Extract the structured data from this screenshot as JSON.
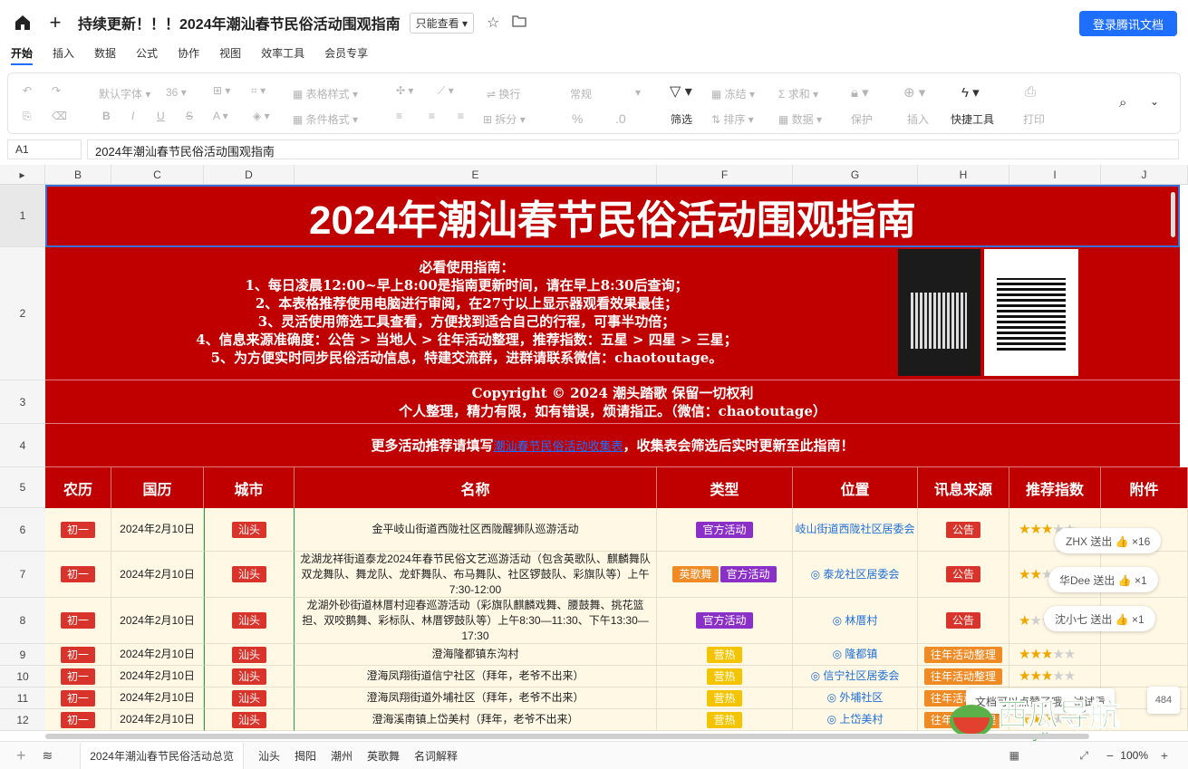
{
  "app": {
    "doc_title": "持续更新！！！2024年潮汕春节民俗活动围观指南",
    "readonly_label": "只能查看",
    "login_button": "登录腾讯文档"
  },
  "menu": [
    "开始",
    "插入",
    "数据",
    "公式",
    "协作",
    "视图",
    "效率工具",
    "会员专享"
  ],
  "toolbar": {
    "font": "默认字体",
    "size": "36",
    "table_style": "表格样式",
    "cond_format": "条件格式",
    "wrap": "换行",
    "split": "拆分",
    "format": "常规",
    "percent": "%",
    "decimal": ".0",
    "filter": "筛选",
    "freeze": "冻结",
    "sort": "排序",
    "sum": "求和",
    "data": "数据",
    "protect": "保护",
    "insert": "插入",
    "quick_tools": "快捷工具",
    "print": "打印"
  },
  "formula_bar": {
    "cell_ref": "A1",
    "content": "2024年潮汕春节民俗活动围观指南"
  },
  "columns": [
    "B",
    "C",
    "D",
    "E",
    "F",
    "G",
    "H",
    "I",
    "J"
  ],
  "sheet": {
    "title": "2024年潮汕春节民俗活动围观指南",
    "guide_heading": "必看使用指南：",
    "guide_lines": [
      "1、每日凌晨12:00~早上8:00是指南更新时间，请在早上8:30后查询；",
      "2、本表格推荐使用电脑进行审阅，在27寸以上显示器观看效果最佳；",
      "3、灵活使用筛选工具查看，方便找到适合自己的行程，可事半功倍；",
      "4、信息来源准确度：公告 > 当地人 > 往年活动整理，推荐指数：五星 > 四星 > 三星；",
      "5、为方便实时同步民俗活动信息，特建交流群，进群请联系微信：chaotoutage。"
    ],
    "copyright": "Copyright © 2024 潮头踏歌 保留一切权利",
    "copyright_sub": "个人整理，精力有限，如有错误，烦请指正。（微信：chaotoutage）",
    "recommend_prefix": "更多活动推荐请填写",
    "recommend_link": "潮汕春节民俗活动收集表",
    "recommend_suffix": "，收集表会筛选后实时更新至此指南！",
    "headers": [
      "农历",
      "国历",
      "城市",
      "名称",
      "类型",
      "位置",
      "讯息来源",
      "推荐指数",
      "附件"
    ],
    "rows": [
      {
        "lunar": "初一",
        "date": "2024年2月10日",
        "city": "汕头",
        "name": "金平岐山街道西陇社区西陇醒狮队巡游活动",
        "types": [
          "官方活动"
        ],
        "loc": "岐山街道西陇社区居委会",
        "source": "公告",
        "stars": 3
      },
      {
        "lunar": "初一",
        "date": "2024年2月10日",
        "city": "汕头",
        "name": "龙湖龙祥街道泰龙2024年春节民俗文艺巡游活动（包含英歌队、麒麟舞队双龙舞队、舞龙队、龙虾舞队、布马舞队、社区锣鼓队、彩旗队等）上午7:30-12:00",
        "types": [
          "英歌舞",
          "官方活动"
        ],
        "loc": "◎ 泰龙社区居委会",
        "source": "公告",
        "stars": 2
      },
      {
        "lunar": "初一",
        "date": "2024年2月10日",
        "city": "汕头",
        "name": "龙湖外砂街道林厝村迎春巡游活动（彩旗队麒麟戏舞、腰鼓舞、挑花篮担、双咬鹅舞、彩标队、林厝锣鼓队等）上午8:30—11:30、下午13:30—17:30",
        "types": [
          "官方活动"
        ],
        "loc": "◎ 林厝村",
        "source": "公告",
        "stars": 1
      },
      {
        "lunar": "初一",
        "date": "2024年2月10日",
        "city": "汕头",
        "name": "澄海隆都镇东沟村",
        "types": [
          "营热"
        ],
        "loc": "◎ 隆都镇",
        "source": "往年活动整理",
        "stars": 3
      },
      {
        "lunar": "初一",
        "date": "2024年2月10日",
        "city": "汕头",
        "name": "澄海凤翔街道信宁社区（拜年，老爷不出来）",
        "types": [
          "营热"
        ],
        "loc": "◎ 信宁社区居委会",
        "source": "往年活动整理",
        "stars": 3
      },
      {
        "lunar": "初一",
        "date": "2024年2月10日",
        "city": "汕头",
        "name": "澄海凤翔街道外埔社区（拜年，老爷不出来）",
        "types": [
          "营热"
        ],
        "loc": "◎ 外埔社区",
        "source": "往年活动整理",
        "stars": 3
      },
      {
        "lunar": "初一",
        "date": "2024年2月10日",
        "city": "汕头",
        "name": "澄海溪南镇上岱美村（拜年，老爷不出来）",
        "types": [
          "营热"
        ],
        "loc": "◎ 上岱美村",
        "source": "往年活动整理",
        "stars": 3
      }
    ]
  },
  "toasts": [
    {
      "text": "ZHX 送出 👍 ×16"
    },
    {
      "text": "华Dee 送出 👍 ×1"
    },
    {
      "text": "沈小七 送出 👍 ×1"
    }
  ],
  "hint": "文档可以点赞了哦，试试看",
  "hint_count": "484",
  "watermark": "西瓜导航",
  "watermark_url": "www.xgdh.cn",
  "sheet_tabs": [
    "2024年潮汕春节民俗活动总览",
    "汕头",
    "揭阳",
    "潮州",
    "英歌舞",
    "名词解释"
  ],
  "zoom": "100%",
  "colors": {
    "red": "#c00000",
    "accent": "#1e6fff"
  }
}
